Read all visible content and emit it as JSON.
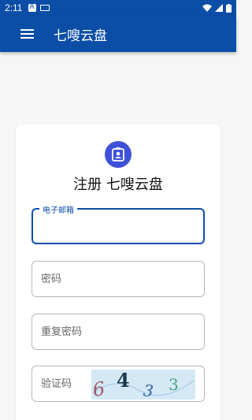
{
  "status_bar": {
    "time": "2:11"
  },
  "app_bar": {
    "title": "七嗖云盘"
  },
  "register_card": {
    "title": "注册 七嗖云盘",
    "email": {
      "label": "电子邮箱",
      "value": ""
    },
    "password": {
      "placeholder": "密码"
    },
    "confirm_password": {
      "placeholder": "重复密码"
    },
    "captcha": {
      "placeholder": "验证码",
      "image_text": [
        "6",
        "4",
        "3",
        "3"
      ]
    }
  },
  "colors": {
    "primary": "#0b4ea8",
    "accent": "#3f51d8",
    "captcha_bg": "#d4e8f6"
  }
}
